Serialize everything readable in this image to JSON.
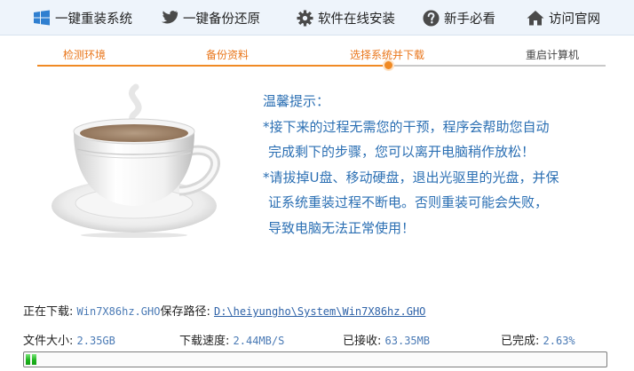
{
  "nav": {
    "items": [
      {
        "label": "一键重装系统",
        "icon": "windows-icon"
      },
      {
        "label": "一键备份还原",
        "icon": "bird-icon"
      },
      {
        "label": "软件在线安装",
        "icon": "gear-icon"
      },
      {
        "label": "新手必看",
        "icon": "help-icon"
      },
      {
        "label": "访问官网",
        "icon": "home-icon"
      }
    ]
  },
  "steps": {
    "items": [
      "检测环境",
      "备份资料",
      "选择系统并下载",
      "重启计算机"
    ],
    "current_index": 2
  },
  "tips": {
    "title": "温馨提示：",
    "lines": [
      "*接下来的过程无需您的干预，程序会帮助您自动",
      "完成剩下的步骤，您可以离开电脑稍作放松！",
      "*请拔掉U盘、移动硬盘，退出光驱里的光盘，并保",
      "证系统重装过程不断电。否则重装可能会失败，",
      "导致电脑无法正常使用！"
    ]
  },
  "download": {
    "downloading_label": "正在下载:",
    "file_name": "Win7X86hz.GHO",
    "save_path_label": "保存路径:",
    "save_path": "D:\\heiyungho\\System\\Win7X86hz.GHO",
    "file_size_label": "文件大小:",
    "file_size": "2.35GB",
    "speed_label": "下载速度:",
    "speed": "2.44MB/S",
    "received_label": "已接收:",
    "received": "63.35MB",
    "completed_label": "已完成:",
    "completed": "2.63%",
    "progress_percent": 2.63,
    "progress_color": "#1db51d"
  },
  "colors": {
    "accent": "#f08a24",
    "tip_text": "#2b6fb3"
  }
}
